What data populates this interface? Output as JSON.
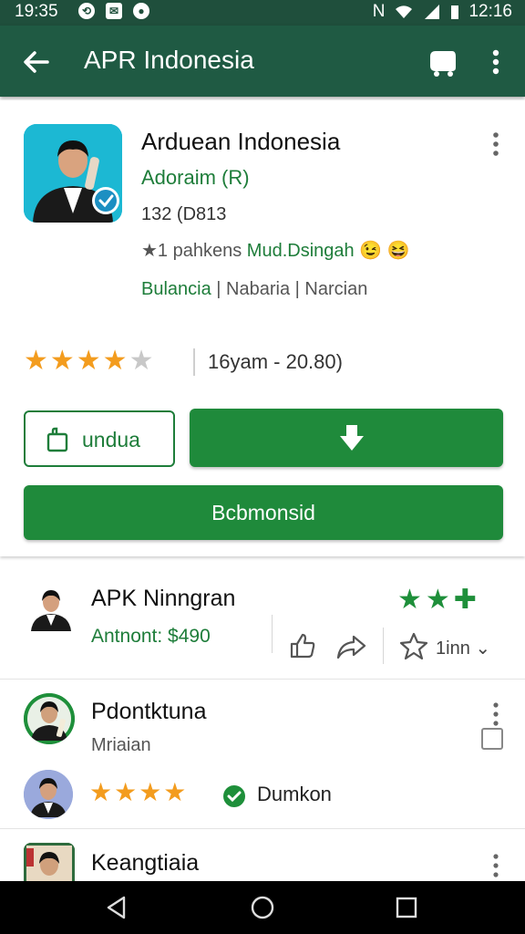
{
  "status_bar": {
    "time_left": "19:35",
    "time_right": "12:16",
    "network": "N"
  },
  "app_bar": {
    "title": "APR Indonesia"
  },
  "app": {
    "name": "Arduean Indonesia",
    "developer": "Adoraim (R)",
    "meta": "132 (D813",
    "meta2_prefix": "★1 pahkens",
    "meta2_link": "Mud.Dsingah",
    "meta2_emoji": "😉 😆",
    "category_primary": "Bulancia",
    "category_2": "Nabaria",
    "category_3": "Narcian",
    "rating_stars": 4.5,
    "rating_text": "16yam - 20.80)"
  },
  "buttons": {
    "outline_label": "undua",
    "wide_label": "Bcbmonsid"
  },
  "list": {
    "row1": {
      "name": "APK Ninngran",
      "amount": "Antnont: $490",
      "sort_label": "1inn ⌄"
    },
    "row2": {
      "name": "Pdontktuna",
      "subtitle": "Mriaian",
      "badge_text": "Dumkon",
      "rating_stars": 3.5
    },
    "row3": {
      "name": "Keangtiaia"
    }
  },
  "colors": {
    "app_bar": "#1f5a43",
    "accent_green": "#1f8a3b",
    "star": "#f39c1e"
  }
}
